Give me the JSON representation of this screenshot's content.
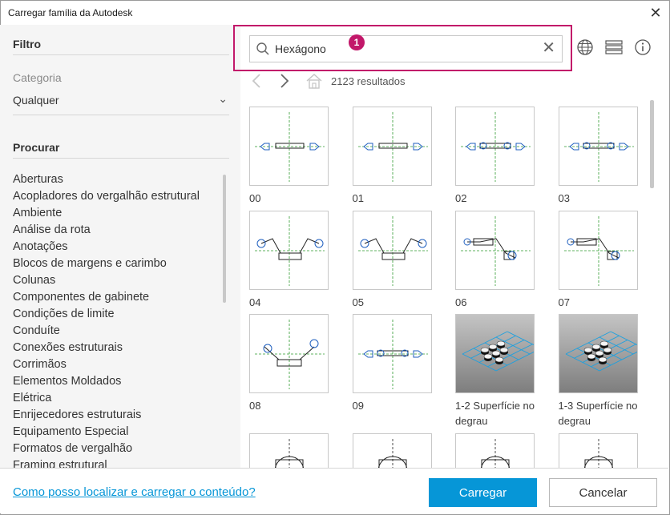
{
  "window": {
    "title": "Carregar família da Autodesk"
  },
  "filter": {
    "title": "Filtro",
    "category_label": "Categoria",
    "category_value": "Qualquer"
  },
  "browse": {
    "title": "Procurar",
    "items": [
      "Aberturas",
      "Acopladores do vergalhão estrutural",
      "Ambiente",
      "Análise da rota",
      "Anotações",
      "Blocos de margens e carimbo",
      "Colunas",
      "Componentes de gabinete",
      "Condições de limite",
      "Conduíte",
      "Conexões estruturais",
      "Corrimãos",
      "Elementos Moldados",
      "Elétrica",
      "Enrijecedores estruturais",
      "Equipamento Especial",
      "Formatos de vergalhão",
      "Framing estrutural"
    ]
  },
  "search": {
    "value": "Hexágono",
    "badge": "1"
  },
  "results": {
    "count_text": "2123 resultados"
  },
  "cards": [
    {
      "label": "00",
      "kind": "linear"
    },
    {
      "label": "01",
      "kind": "linear"
    },
    {
      "label": "02",
      "kind": "linear-circle"
    },
    {
      "label": "03",
      "kind": "linear-circle"
    },
    {
      "label": "04",
      "kind": "offset"
    },
    {
      "label": "05",
      "kind": "offset"
    },
    {
      "label": "06",
      "kind": "offset-down"
    },
    {
      "label": "07",
      "kind": "offset-down"
    },
    {
      "label": "08",
      "kind": "vee"
    },
    {
      "label": "09",
      "kind": "linear-circle"
    },
    {
      "label": "1-2 Superfície no degrau",
      "kind": "photo"
    },
    {
      "label": "1-3 Superfície no degrau",
      "kind": "photo"
    },
    {
      "label": "",
      "kind": "partial"
    },
    {
      "label": "",
      "kind": "partial"
    },
    {
      "label": "",
      "kind": "partial"
    },
    {
      "label": "",
      "kind": "partial"
    }
  ],
  "footer": {
    "help_link": "Como posso localizar e carregar o conteúdo?",
    "load_button": "Carregar",
    "cancel_button": "Cancelar"
  },
  "colors": {
    "accent": "#0696d7",
    "highlight": "#c2186a"
  }
}
